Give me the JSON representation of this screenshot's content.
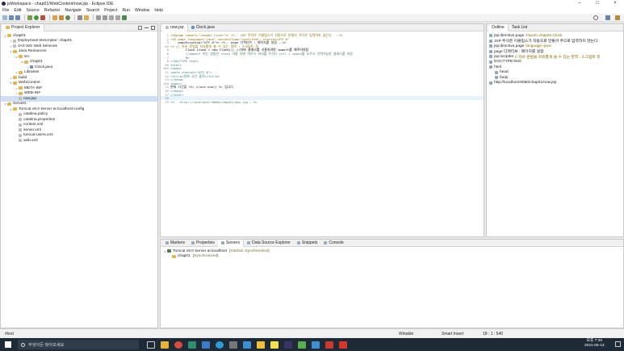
{
  "window": {
    "title": "jsWorkspace - chap01/WebContent/now.jsp - Eclipse IDE"
  },
  "menu": [
    "File",
    "Edit",
    "Source",
    "Refactor",
    "Navigate",
    "Search",
    "Project",
    "Run",
    "Window",
    "Help"
  ],
  "explorer": {
    "tab": "Project Explorer",
    "items": [
      {
        "label": "chap01",
        "level": 0,
        "icon": "project",
        "arrow": "v"
      },
      {
        "label": "Deployment Descriptor: chap01",
        "level": 1,
        "icon": "file",
        "arrow": ">"
      },
      {
        "label": "JAX-WS Web Services",
        "level": 1,
        "icon": "file",
        "arrow": ">"
      },
      {
        "label": "Java Resources",
        "level": 1,
        "icon": "folder",
        "arrow": "v"
      },
      {
        "label": "src",
        "level": 2,
        "icon": "folder",
        "arrow": "v"
      },
      {
        "label": "chap01",
        "level": 3,
        "icon": "folder",
        "arrow": "v"
      },
      {
        "label": "Clock.java",
        "level": 4,
        "icon": "java",
        "arrow": ">"
      },
      {
        "label": "Libraries",
        "level": 2,
        "icon": "folder",
        "arrow": ">"
      },
      {
        "label": "build",
        "level": 1,
        "icon": "folder",
        "arrow": ">"
      },
      {
        "label": "WebContent",
        "level": 1,
        "icon": "folder",
        "arrow": "v"
      },
      {
        "label": "META-INF",
        "level": 2,
        "icon": "folder",
        "arrow": ">"
      },
      {
        "label": "WEB-INF",
        "level": 2,
        "icon": "folder",
        "arrow": ">"
      },
      {
        "label": "now.jsp",
        "level": 2,
        "icon": "file",
        "arrow": "",
        "selected": true
      },
      {
        "label": "Servers",
        "level": 0,
        "icon": "folder",
        "arrow": "v"
      },
      {
        "label": "Tomcat v9.0 Server at localhost-config",
        "level": 1,
        "icon": "folder",
        "arrow": "v"
      },
      {
        "label": "catalina.policy",
        "level": 2,
        "icon": "file",
        "arrow": ""
      },
      {
        "label": "catalina.properties",
        "level": 2,
        "icon": "file",
        "arrow": ""
      },
      {
        "label": "context.xml",
        "level": 2,
        "icon": "file",
        "arrow": ""
      },
      {
        "label": "server.xml",
        "level": 2,
        "icon": "file",
        "arrow": ""
      },
      {
        "label": "tomcat-users.xml",
        "level": 2,
        "icon": "file",
        "arrow": ""
      },
      {
        "label": "web.xml",
        "level": 2,
        "icon": "file",
        "arrow": ""
      }
    ]
  },
  "editor": {
    "tabs": [
      {
        "label": "now.jsp",
        "active": true
      },
      {
        "label": "Clock.java",
        "active": false
      }
    ],
    "lines": [
      {
        "n": "1",
        "text": "<%@page import=\"chap01.Clock\"%> <%-- JSP 주석은 이클립스가 자동으로 만들어 주므로 입력하지 않는다. --%>"
      },
      {
        "n": "2",
        "text": "<%@ page language=\"java\" contentType=\"text/html; charset=UTF-8\""
      },
      {
        "n": "3",
        "text": "    pageEncoding=\"UTF-8\"%> <%-- page 디렉티브 : 페이지를 설정 --%>"
      },
      {
        "n": "4⊖",
        "text": "<% // 자바 문법을 자유롭게 쓸 수 있는 영역 : 스크립트 릿"
      },
      {
        "n": "5",
        "text": "        Clock clock = new Clock(); //자바 클래스를 사용하려면 import를 해주어야함"
      },
      {
        "n": "6",
        "text": "        //import 하는 방법은 class 이름 뒤에 마우스 커서를 두거나 ctrl + space를 누르고 선택가능한 클래스를 지정"
      },
      {
        "n": "7",
        "text": "        %>"
      },
      {
        "n": "8",
        "text": "<!DOCTYPE html>"
      },
      {
        "n": "9⊖",
        "text": "<html>"
      },
      {
        "n": "10⊖",
        "text": "<head>"
      },
      {
        "n": "11",
        "text": "<meta charset=\"UTF-8\">"
      },
      {
        "n": "12",
        "text": "<title>현재 시간 출력</title>"
      },
      {
        "n": "13",
        "text": "</head>"
      },
      {
        "n": "14⊖",
        "text": "<body>"
      },
      {
        "n": "15",
        "text": "현재 시간을 <%= clock.now() %> 입니다."
      },
      {
        "n": "16",
        "text": "</body>"
      },
      {
        "n": "17",
        "text": "</html>"
      },
      {
        "n": "18",
        "text": ""
      },
      {
        "n": "19",
        "text": "<%-- http://localhost:8080/chap01/now.jsp --%>"
      }
    ]
  },
  "outline": {
    "tabs": [
      "Outline",
      "Task List"
    ],
    "items": [
      {
        "label": "jsp:directive.page",
        "extra": "import=chap01.Clock",
        "level": 0
      },
      {
        "label": "JSP 주석은 이클립스가 자동으로 만들어 주므로 입력하지 않는다.",
        "extra": "",
        "level": 0
      },
      {
        "label": "jsp:directive.page",
        "extra": "language=java",
        "level": 0
      },
      {
        "label": "page 디렉티브 : 페이지를 설정",
        "extra": "",
        "level": 0
      },
      {
        "label": "jsp:scriptlet",
        "extra": "// 자바 문법을 자유롭게 쓸 수 있는 영역 : 스크립트 릿",
        "level": 0
      },
      {
        "label": "DOCTYPE:html",
        "extra": "",
        "level": 0
      },
      {
        "label": "html",
        "extra": "",
        "level": 0
      },
      {
        "label": "head",
        "extra": "",
        "level": 1
      },
      {
        "label": "body",
        "extra": "",
        "level": 1
      },
      {
        "label": "http://localhost:8080/chap01/now.jsp",
        "extra": "",
        "level": 0
      }
    ]
  },
  "bottom": {
    "tabs": [
      "Markers",
      "Properties",
      "Servers",
      "Data Source Explorer",
      "Snippets",
      "Console"
    ],
    "server": "Tomcat v9.0 Server at localhost",
    "server_state": "[Started, Synchronized]",
    "module": "chap01",
    "module_state": "[Synchronized]"
  },
  "status": {
    "item": "#text",
    "writable": "Writable",
    "insert": "Smart Insert",
    "pos": "18 : 1 : 540"
  },
  "taskbar": {
    "search_placeholder": "무엇이든 찾아보세요",
    "time": "오후 7:35",
    "date": "2021-05-13"
  },
  "colors": {
    "keyword": "#7f0055",
    "comment": "#3f7f5f",
    "tag": "#3f7f7f",
    "string": "#2a00ff",
    "jsp": "#8a6d00"
  }
}
